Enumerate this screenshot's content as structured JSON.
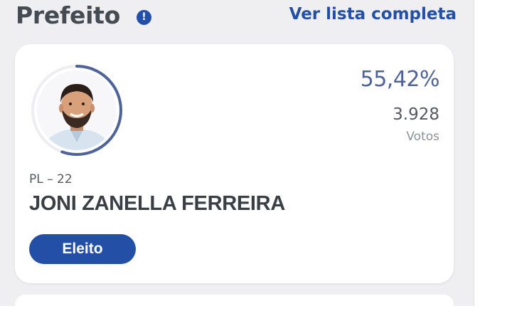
{
  "header": {
    "title": "Prefeito",
    "info_icon": "!",
    "list_link": "Ver lista completa"
  },
  "card": {
    "avatar_icon": "candidate-photo",
    "progress_fraction": 0.5542,
    "percent": "55,42%",
    "votes_count": "3.928",
    "votes_label": "Votos",
    "party": "PL – 22",
    "candidate_name": "JONI ZANELLA FERREIRA",
    "status_badge": "Eleito"
  },
  "colors": {
    "accent": "#2350a6",
    "percent": "#4e6399",
    "panel_bg": "#efeff1"
  }
}
